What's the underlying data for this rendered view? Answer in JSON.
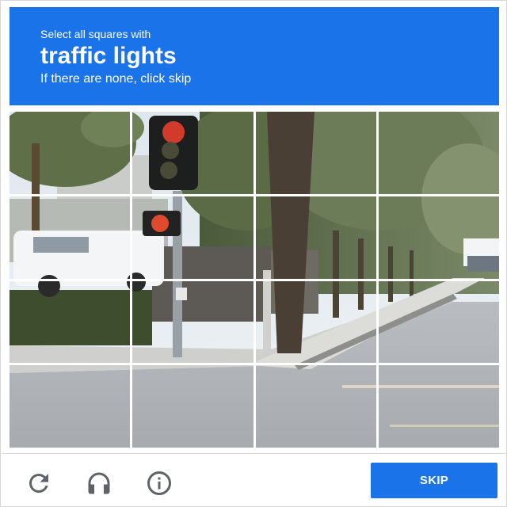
{
  "challenge": {
    "instruction": "Select all squares with",
    "target": "traffic lights",
    "hint": "If there are none, click skip"
  },
  "grid": {
    "rows": 4,
    "cols": 4,
    "selected": []
  },
  "footer": {
    "skip_label": "SKIP",
    "icons": [
      "reload-icon",
      "audio-icon",
      "info-icon"
    ]
  },
  "colors": {
    "accent": "#1a73e8"
  }
}
